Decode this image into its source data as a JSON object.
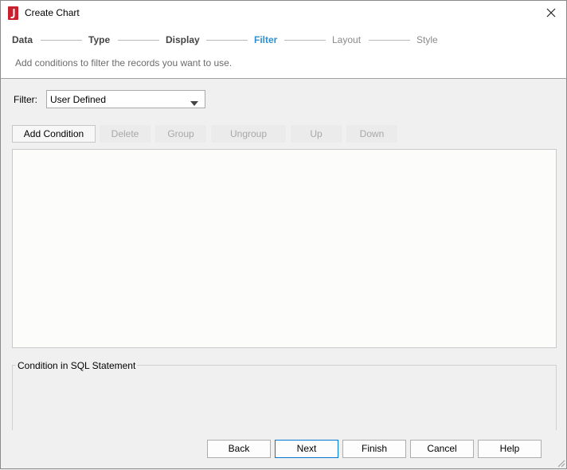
{
  "window": {
    "title": "Create Chart"
  },
  "steps": [
    {
      "label": "Data",
      "state": "done"
    },
    {
      "label": "Type",
      "state": "done"
    },
    {
      "label": "Display",
      "state": "done"
    },
    {
      "label": "Filter",
      "state": "active"
    },
    {
      "label": "Layout",
      "state": "todo"
    },
    {
      "label": "Style",
      "state": "todo"
    }
  ],
  "subtitle": "Add conditions to filter the records you want to use.",
  "filter": {
    "label": "Filter:",
    "value": "User Defined"
  },
  "toolbar": {
    "add": "Add Condition",
    "delete": "Delete",
    "group": "Group",
    "ungroup": "Ungroup",
    "up": "Up",
    "down": "Down"
  },
  "sql": {
    "legend": "Condition in SQL Statement"
  },
  "footer": {
    "back": "Back",
    "next": "Next",
    "finish": "Finish",
    "cancel": "Cancel",
    "help": "Help"
  },
  "colors": {
    "active_step": "#2f8fcf",
    "app_icon": "#c8202c",
    "default_button_border": "#0078d7"
  }
}
